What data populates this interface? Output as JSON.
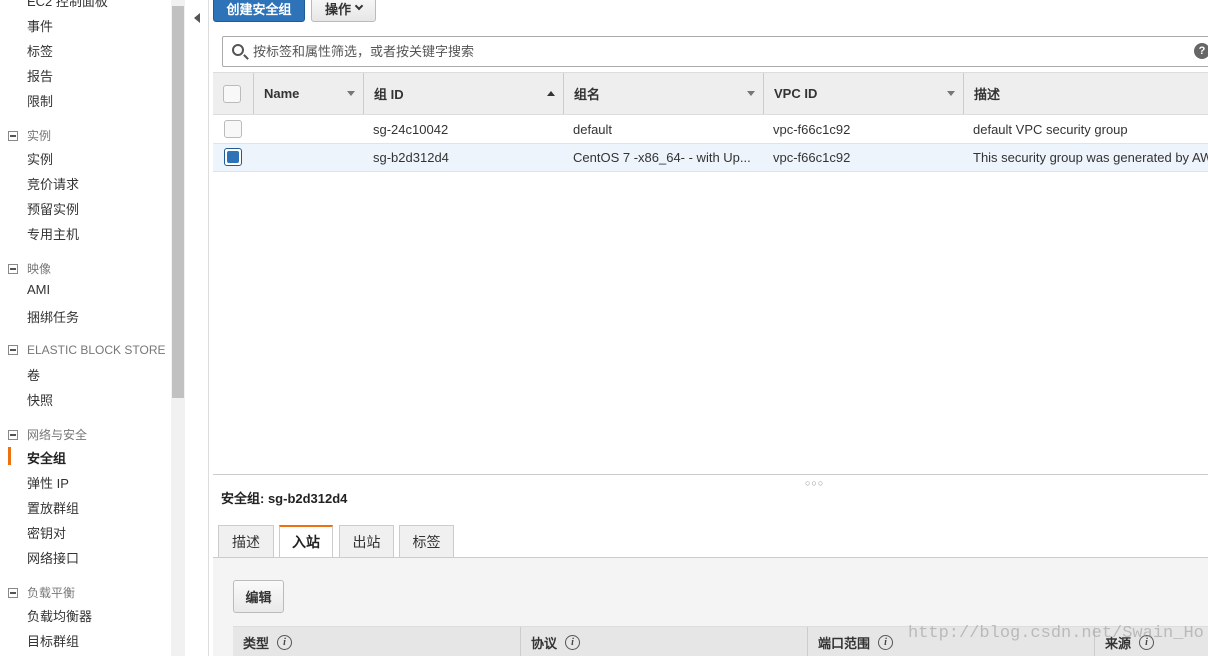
{
  "sidebar": {
    "top_items": [
      "EC2 控制面板",
      "事件",
      "标签",
      "报告",
      "限制"
    ],
    "sections": [
      {
        "title": "实例",
        "items": [
          "实例",
          "竞价请求",
          "预留实例",
          "专用主机"
        ]
      },
      {
        "title": "映像",
        "items": [
          "AMI",
          "捆绑任务"
        ]
      },
      {
        "title": "ELASTIC BLOCK STORE",
        "items": [
          "卷",
          "快照"
        ]
      },
      {
        "title": "网络与安全",
        "items": [
          "安全组",
          "弹性 IP",
          "置放群组",
          "密钥对",
          "网络接口"
        ]
      },
      {
        "title": "负载平衡",
        "items": [
          "负载均衡器",
          "目标群组"
        ]
      }
    ],
    "active_item": "安全组",
    "accent_color": "#ec7211"
  },
  "toolbar": {
    "create_label": "创建安全组",
    "actions_label": "操作"
  },
  "search": {
    "placeholder": "按标签和属性筛选，或者按关键字搜索",
    "value": ""
  },
  "table": {
    "columns": [
      "Name",
      "组 ID",
      "组名",
      "VPC ID",
      "描述"
    ],
    "sorted_column": "组 ID",
    "rows": [
      {
        "name": "",
        "group_id": "sg-24c10042",
        "group_name": "default",
        "vpc_id": "vpc-f66c1c92",
        "description": "default VPC security group",
        "selected": false
      },
      {
        "name": "",
        "group_id": "sg-b2d312d4",
        "group_name": "CentOS 7 -x86_64- - with Up...",
        "vpc_id": "vpc-f66c1c92",
        "description": "This security group was generated by AWS Marketplace",
        "selected": true
      }
    ]
  },
  "detail": {
    "title": "安全组: sg-b2d312d4",
    "tabs": [
      "描述",
      "入站",
      "出站",
      "标签"
    ],
    "active_tab": "入站",
    "edit_label": "编辑",
    "rule_columns": [
      "类型",
      "协议",
      "端口范围",
      "来源"
    ]
  },
  "watermark": "http://blog.csdn.net/Swain_Ho",
  "colors": {
    "primary": "#2e73b8",
    "selected_row": "#edf4fc"
  }
}
